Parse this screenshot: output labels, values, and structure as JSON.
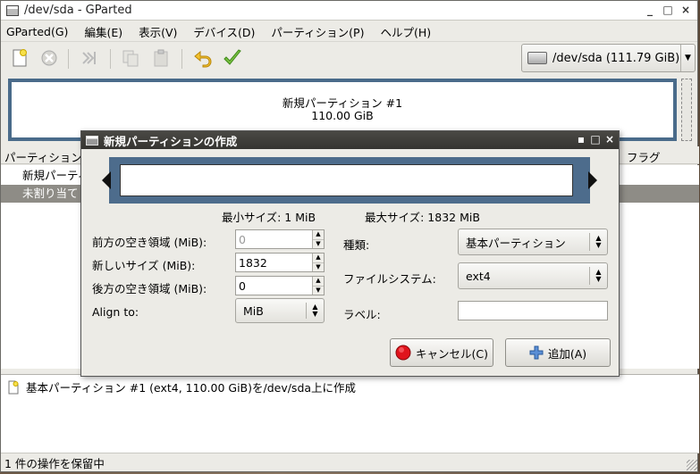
{
  "main_window": {
    "title": "/dev/sda - GParted",
    "controls": [
      "_",
      "□",
      "×"
    ]
  },
  "menu": [
    "GParted(G)",
    "編集(E)",
    "表示(V)",
    "デバイス(D)",
    "パーティション(P)",
    "ヘルプ(H)"
  ],
  "toolbar": {
    "icons": [
      "new-icon",
      "delete-icon",
      "resize-move-icon",
      "copy-icon",
      "paste-icon",
      "undo-icon",
      "apply-icon"
    ],
    "device_label": "/dev/sda  (111.79 GiB)"
  },
  "partition_map": {
    "name": "新規パーティション #1",
    "size": "110.00 GiB"
  },
  "table": {
    "headers": {
      "partition": "パーティション",
      "flags": "フラグ"
    },
    "rows": [
      "新規パーティ",
      "未割り当て"
    ]
  },
  "operations": {
    "item": "基本パーティション #1 (ext4, 110.00 GiB)を/dev/sda上に作成"
  },
  "status": "1 件の操作を保留中",
  "dialog": {
    "title": "新規パーティションの作成",
    "min_size": "最小サイズ: 1 MiB",
    "max_size": "最大サイズ: 1832 MiB",
    "labels": {
      "free_before": "前方の空き領域 (MiB):",
      "new_size": "新しいサイズ (MiB):",
      "free_after": "後方の空き領域 (MiB):",
      "align": "Align to:",
      "type": "種類:",
      "filesystem": "ファイルシステム:",
      "label": "ラベル:"
    },
    "values": {
      "free_before": "0",
      "new_size": "1832",
      "free_after": "0",
      "align": "MiB",
      "type": "基本パーティション",
      "filesystem": "ext4",
      "label": ""
    },
    "buttons": {
      "cancel": "キャンセル(C)",
      "add": "追加(A)"
    }
  },
  "colors": {
    "map_border": "#4a6b8a",
    "selection": "#8e8c86",
    "dialog_title": "#3f3e3a"
  }
}
